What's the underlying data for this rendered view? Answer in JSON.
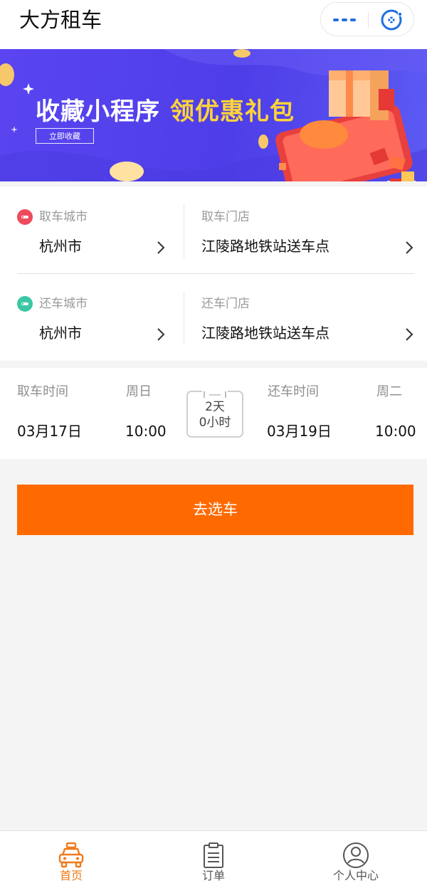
{
  "header": {
    "title": "大方租车"
  },
  "banner": {
    "title_main": "收藏小程序",
    "title_highlight": "领优惠礼包",
    "button_label": "立即收藏"
  },
  "pickup": {
    "city_label": "取车城市",
    "city_value": "杭州市",
    "store_label": "取车门店",
    "store_value": "江陵路地铁站送车点"
  },
  "return": {
    "city_label": "还车城市",
    "city_value": "杭州市",
    "store_label": "还车门店",
    "store_value": "江陵路地铁站送车点"
  },
  "time": {
    "pickup_label": "取车时间",
    "pickup_weekday": "周日",
    "pickup_date": "03月17日",
    "pickup_time": "10:00",
    "duration_days": "2天",
    "duration_hours": "0小时",
    "return_label": "还车时间",
    "return_weekday": "周二",
    "return_date": "03月19日",
    "return_time": "10:00"
  },
  "action": {
    "select_car_label": "去选车"
  },
  "tabbar": {
    "items": [
      {
        "label": "首页",
        "icon": "car-icon",
        "active": true
      },
      {
        "label": "订单",
        "icon": "clipboard-icon",
        "active": false
      },
      {
        "label": "个人中心",
        "icon": "user-icon",
        "active": false
      }
    ]
  },
  "colors": {
    "accent": "#ff6a00",
    "banner_bg": "#5244ec",
    "banner_highlight": "#ffd43a",
    "pickup_dot": "#ee4b5c",
    "return_dot": "#3cc7a4",
    "tab_active": "#f07a1a",
    "tab_inactive": "#555555"
  }
}
